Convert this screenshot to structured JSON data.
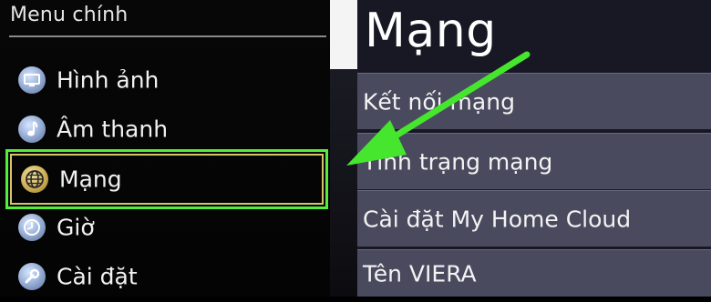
{
  "sidebar": {
    "title": "Menu chính",
    "items": [
      {
        "label": "Hình ảnh",
        "icon": "picture-icon"
      },
      {
        "label": "Âm thanh",
        "icon": "music-note-icon"
      },
      {
        "label": "Mạng",
        "icon": "globe-icon",
        "selected": true
      },
      {
        "label": "Giờ",
        "icon": "clock-icon"
      },
      {
        "label": "Cài đặt",
        "icon": "wrench-icon"
      }
    ]
  },
  "submenu": {
    "title": "Mạng",
    "items": [
      {
        "label": "Kết nối mạng"
      },
      {
        "label": "Tình trạng mạng"
      },
      {
        "label": "Cài đặt My Home Cloud"
      },
      {
        "label": "Tên VIERA"
      }
    ]
  },
  "annotation": {
    "arrow_icon": "green-arrow-icon",
    "color": "#45e62d"
  },
  "colors": {
    "selection_outline": "#52ee3a",
    "selection_inner": "#d7c46a",
    "submenu_row_bg": "#4a4a5e"
  }
}
